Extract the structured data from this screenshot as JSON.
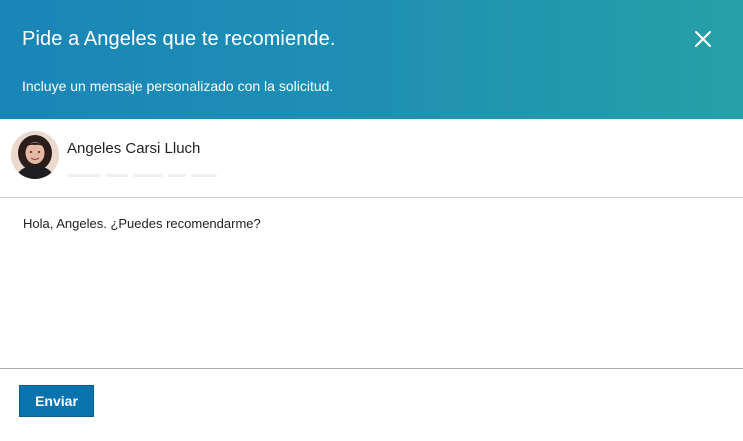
{
  "header": {
    "title": "Pide a Angeles que te recomiende.",
    "subtitle": "Incluye un mensaje personalizado con la solicitud.",
    "close_icon": "close-icon"
  },
  "recipient": {
    "name": "Angeles Carsi Lluch",
    "avatar_icon": "avatar"
  },
  "message": {
    "text": "Hola, Angeles. ¿Puedes recomendarme?"
  },
  "actions": {
    "send_label": "Enviar"
  },
  "colors": {
    "header_start": "#1a85b8",
    "header_end": "#26a0a7",
    "button": "#0a72ad"
  }
}
